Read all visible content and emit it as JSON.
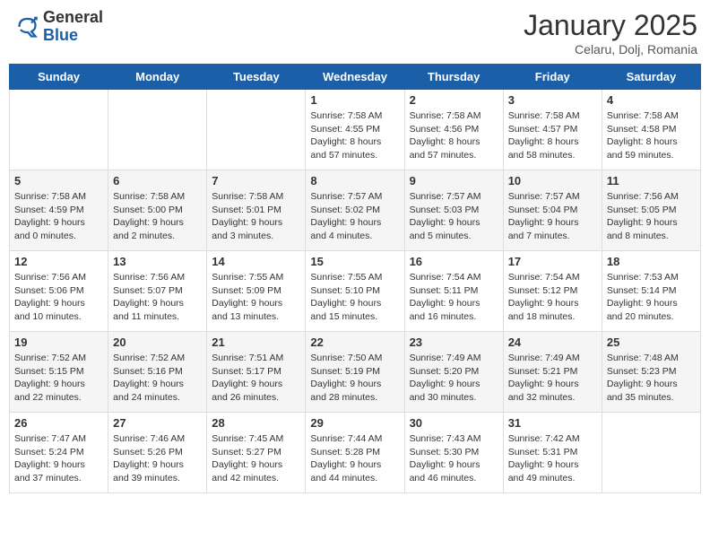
{
  "header": {
    "logo_general": "General",
    "logo_blue": "Blue",
    "month_year": "January 2025",
    "location": "Celaru, Dolj, Romania"
  },
  "weekdays": [
    "Sunday",
    "Monday",
    "Tuesday",
    "Wednesday",
    "Thursday",
    "Friday",
    "Saturday"
  ],
  "weeks": [
    [
      {
        "day": null,
        "info": null
      },
      {
        "day": null,
        "info": null
      },
      {
        "day": null,
        "info": null
      },
      {
        "day": "1",
        "info": "Sunrise: 7:58 AM\nSunset: 4:55 PM\nDaylight: 8 hours\nand 57 minutes."
      },
      {
        "day": "2",
        "info": "Sunrise: 7:58 AM\nSunset: 4:56 PM\nDaylight: 8 hours\nand 57 minutes."
      },
      {
        "day": "3",
        "info": "Sunrise: 7:58 AM\nSunset: 4:57 PM\nDaylight: 8 hours\nand 58 minutes."
      },
      {
        "day": "4",
        "info": "Sunrise: 7:58 AM\nSunset: 4:58 PM\nDaylight: 8 hours\nand 59 minutes."
      }
    ],
    [
      {
        "day": "5",
        "info": "Sunrise: 7:58 AM\nSunset: 4:59 PM\nDaylight: 9 hours\nand 0 minutes."
      },
      {
        "day": "6",
        "info": "Sunrise: 7:58 AM\nSunset: 5:00 PM\nDaylight: 9 hours\nand 2 minutes."
      },
      {
        "day": "7",
        "info": "Sunrise: 7:58 AM\nSunset: 5:01 PM\nDaylight: 9 hours\nand 3 minutes."
      },
      {
        "day": "8",
        "info": "Sunrise: 7:57 AM\nSunset: 5:02 PM\nDaylight: 9 hours\nand 4 minutes."
      },
      {
        "day": "9",
        "info": "Sunrise: 7:57 AM\nSunset: 5:03 PM\nDaylight: 9 hours\nand 5 minutes."
      },
      {
        "day": "10",
        "info": "Sunrise: 7:57 AM\nSunset: 5:04 PM\nDaylight: 9 hours\nand 7 minutes."
      },
      {
        "day": "11",
        "info": "Sunrise: 7:56 AM\nSunset: 5:05 PM\nDaylight: 9 hours\nand 8 minutes."
      }
    ],
    [
      {
        "day": "12",
        "info": "Sunrise: 7:56 AM\nSunset: 5:06 PM\nDaylight: 9 hours\nand 10 minutes."
      },
      {
        "day": "13",
        "info": "Sunrise: 7:56 AM\nSunset: 5:07 PM\nDaylight: 9 hours\nand 11 minutes."
      },
      {
        "day": "14",
        "info": "Sunrise: 7:55 AM\nSunset: 5:09 PM\nDaylight: 9 hours\nand 13 minutes."
      },
      {
        "day": "15",
        "info": "Sunrise: 7:55 AM\nSunset: 5:10 PM\nDaylight: 9 hours\nand 15 minutes."
      },
      {
        "day": "16",
        "info": "Sunrise: 7:54 AM\nSunset: 5:11 PM\nDaylight: 9 hours\nand 16 minutes."
      },
      {
        "day": "17",
        "info": "Sunrise: 7:54 AM\nSunset: 5:12 PM\nDaylight: 9 hours\nand 18 minutes."
      },
      {
        "day": "18",
        "info": "Sunrise: 7:53 AM\nSunset: 5:14 PM\nDaylight: 9 hours\nand 20 minutes."
      }
    ],
    [
      {
        "day": "19",
        "info": "Sunrise: 7:52 AM\nSunset: 5:15 PM\nDaylight: 9 hours\nand 22 minutes."
      },
      {
        "day": "20",
        "info": "Sunrise: 7:52 AM\nSunset: 5:16 PM\nDaylight: 9 hours\nand 24 minutes."
      },
      {
        "day": "21",
        "info": "Sunrise: 7:51 AM\nSunset: 5:17 PM\nDaylight: 9 hours\nand 26 minutes."
      },
      {
        "day": "22",
        "info": "Sunrise: 7:50 AM\nSunset: 5:19 PM\nDaylight: 9 hours\nand 28 minutes."
      },
      {
        "day": "23",
        "info": "Sunrise: 7:49 AM\nSunset: 5:20 PM\nDaylight: 9 hours\nand 30 minutes."
      },
      {
        "day": "24",
        "info": "Sunrise: 7:49 AM\nSunset: 5:21 PM\nDaylight: 9 hours\nand 32 minutes."
      },
      {
        "day": "25",
        "info": "Sunrise: 7:48 AM\nSunset: 5:23 PM\nDaylight: 9 hours\nand 35 minutes."
      }
    ],
    [
      {
        "day": "26",
        "info": "Sunrise: 7:47 AM\nSunset: 5:24 PM\nDaylight: 9 hours\nand 37 minutes."
      },
      {
        "day": "27",
        "info": "Sunrise: 7:46 AM\nSunset: 5:26 PM\nDaylight: 9 hours\nand 39 minutes."
      },
      {
        "day": "28",
        "info": "Sunrise: 7:45 AM\nSunset: 5:27 PM\nDaylight: 9 hours\nand 42 minutes."
      },
      {
        "day": "29",
        "info": "Sunrise: 7:44 AM\nSunset: 5:28 PM\nDaylight: 9 hours\nand 44 minutes."
      },
      {
        "day": "30",
        "info": "Sunrise: 7:43 AM\nSunset: 5:30 PM\nDaylight: 9 hours\nand 46 minutes."
      },
      {
        "day": "31",
        "info": "Sunrise: 7:42 AM\nSunset: 5:31 PM\nDaylight: 9 hours\nand 49 minutes."
      },
      {
        "day": null,
        "info": null
      }
    ]
  ]
}
